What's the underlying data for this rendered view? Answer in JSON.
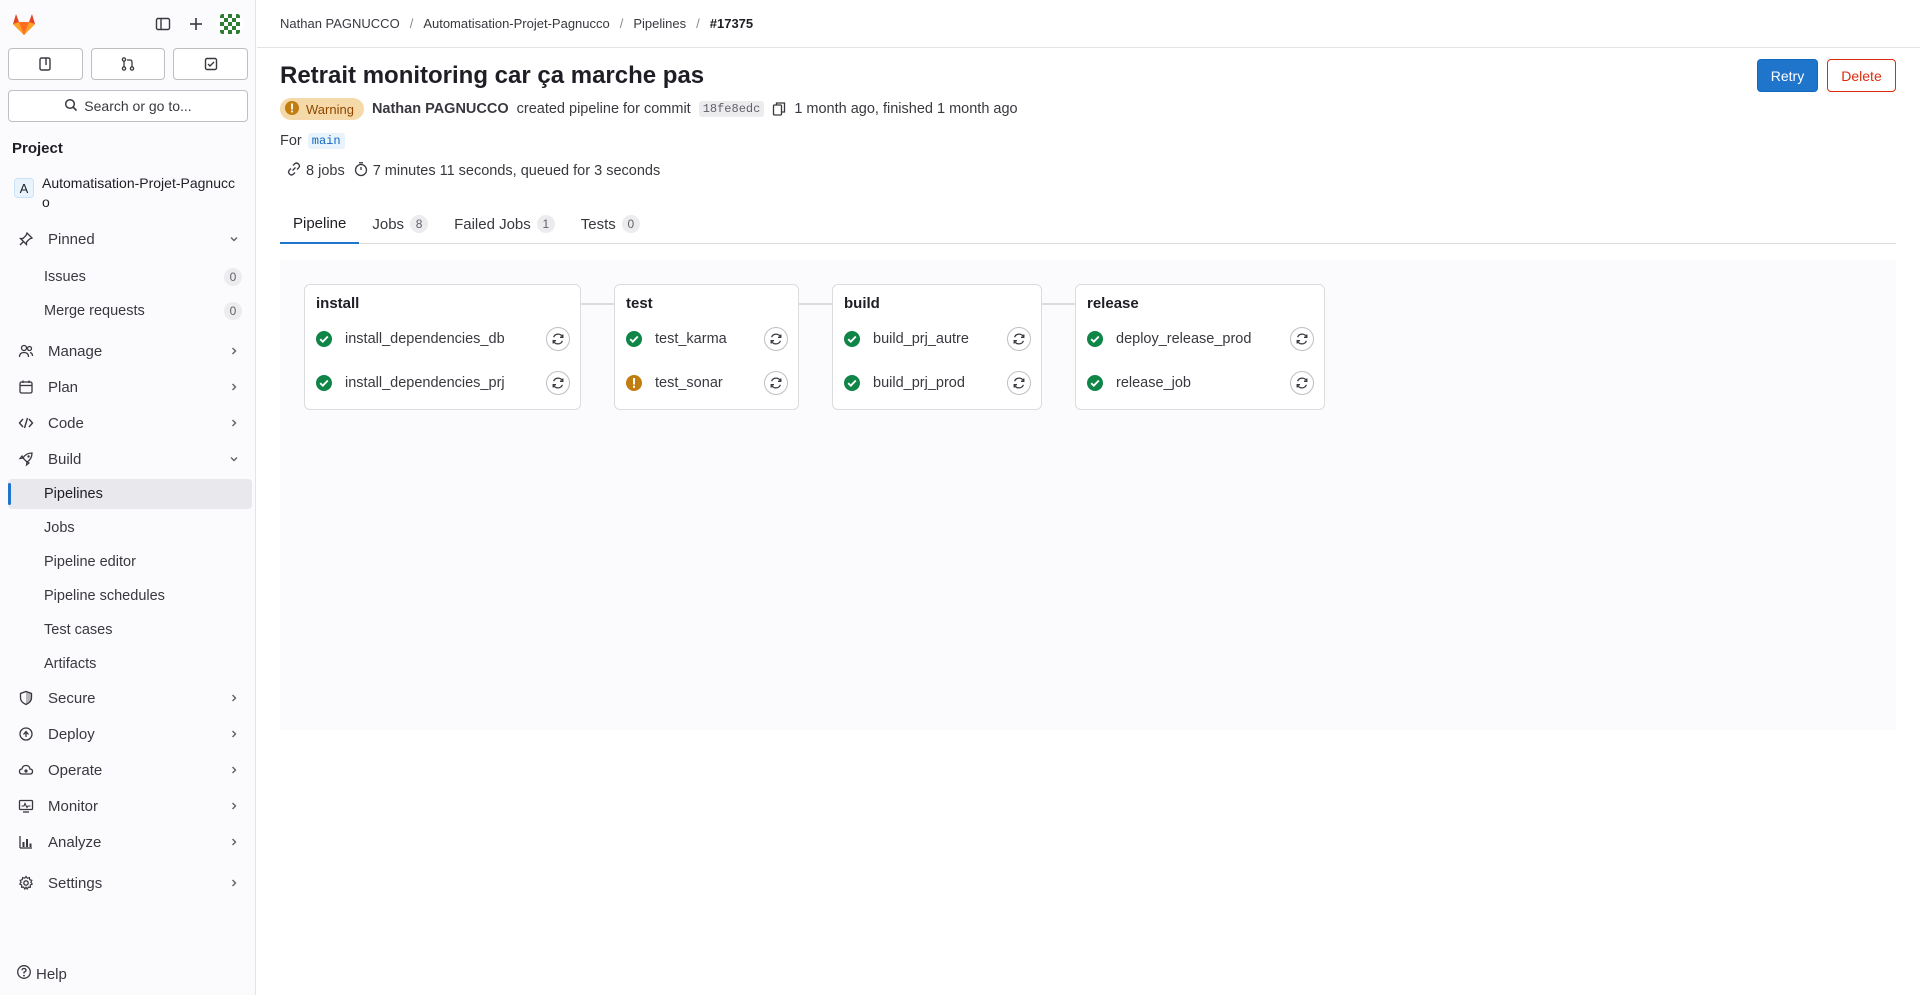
{
  "sidebar": {
    "search_label": "Search or go to...",
    "section_title": "Project",
    "project": {
      "initial": "A",
      "name": "Automatisation-Projet-Pagnucco"
    },
    "pinned": {
      "label": "Pinned",
      "items": [
        {
          "label": "Issues",
          "count": "0"
        },
        {
          "label": "Merge requests",
          "count": "0"
        }
      ]
    },
    "groups": [
      {
        "label": "Manage"
      },
      {
        "label": "Plan"
      },
      {
        "label": "Code"
      }
    ],
    "build": {
      "label": "Build",
      "items": [
        {
          "label": "Pipelines"
        },
        {
          "label": "Jobs"
        },
        {
          "label": "Pipeline editor"
        },
        {
          "label": "Pipeline schedules"
        },
        {
          "label": "Test cases"
        },
        {
          "label": "Artifacts"
        }
      ]
    },
    "groups_after": [
      {
        "label": "Secure"
      },
      {
        "label": "Deploy"
      },
      {
        "label": "Operate"
      },
      {
        "label": "Monitor"
      },
      {
        "label": "Analyze"
      }
    ],
    "settings": "Settings",
    "help": "Help"
  },
  "breadcrumb": [
    "Nathan PAGNUCCO",
    "Automatisation-Projet-Pagnucco",
    "Pipelines",
    "#17375"
  ],
  "pipeline": {
    "title": "Retrait monitoring car ça marche pas",
    "status": "Warning",
    "author": "Nathan PAGNUCCO",
    "action_text": "created pipeline for commit",
    "sha": "18fe8edc",
    "timing": "1 month ago, finished 1 month ago",
    "for_label": "For",
    "branch": "main",
    "jobs_count": "8 jobs",
    "duration": "7 minutes 11 seconds, queued for 3 seconds"
  },
  "actions": {
    "retry": "Retry",
    "delete": "Delete"
  },
  "tabs": [
    {
      "label": "Pipeline",
      "count": null
    },
    {
      "label": "Jobs",
      "count": "8"
    },
    {
      "label": "Failed Jobs",
      "count": "1"
    },
    {
      "label": "Tests",
      "count": "0"
    }
  ],
  "stages": [
    {
      "name": "install",
      "jobs": [
        {
          "name": "install_dependencies_db",
          "status": "success"
        },
        {
          "name": "install_dependencies_prj",
          "status": "success"
        }
      ]
    },
    {
      "name": "test",
      "jobs": [
        {
          "name": "test_karma",
          "status": "success"
        },
        {
          "name": "test_sonar",
          "status": "warning"
        }
      ]
    },
    {
      "name": "build",
      "jobs": [
        {
          "name": "build_prj_autre",
          "status": "success"
        },
        {
          "name": "build_prj_prod",
          "status": "success"
        }
      ]
    },
    {
      "name": "release",
      "jobs": [
        {
          "name": "deploy_release_prod",
          "status": "success"
        },
        {
          "name": "release_job",
          "status": "success"
        }
      ]
    }
  ],
  "colors": {
    "success": "#108548",
    "warning": "#c17d10",
    "accent": "#1f75cb",
    "danger": "#dd2b0e"
  }
}
